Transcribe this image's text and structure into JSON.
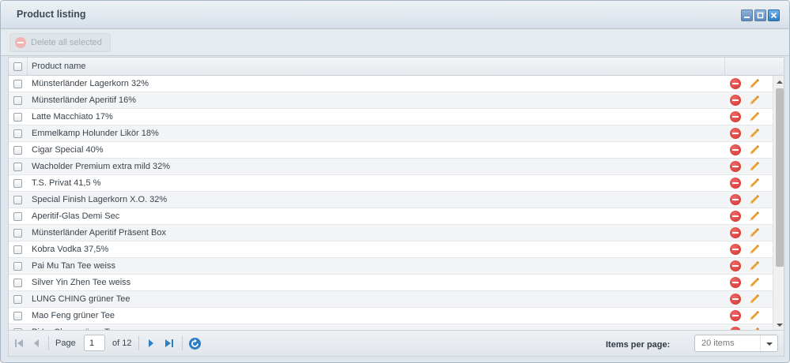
{
  "window": {
    "title": "Product listing",
    "controls": [
      "minimize-icon",
      "maximize-icon",
      "close-icon"
    ]
  },
  "toolbar": {
    "delete_all_label": "Delete all selected"
  },
  "grid": {
    "columns": [
      "Product name"
    ],
    "rows": [
      {
        "name": "Münsterländer Lagerkorn 32%"
      },
      {
        "name": "Münsterländer Aperitif 16%"
      },
      {
        "name": "Latte Macchiato 17%"
      },
      {
        "name": "Emmelkamp Holunder Likör 18%"
      },
      {
        "name": "Cigar Special 40%"
      },
      {
        "name": "Wacholder Premium extra mild 32%"
      },
      {
        "name": "T.S. Privat 41,5 %"
      },
      {
        "name": "Special Finish Lagerkorn X.O. 32%"
      },
      {
        "name": "Aperitif-Glas Demi Sec"
      },
      {
        "name": "Münsterländer Aperitif Präsent Box"
      },
      {
        "name": "Kobra Vodka 37,5%"
      },
      {
        "name": "Pai Mu Tan Tee weiss"
      },
      {
        "name": "Silver Yin Zhen Tee weiss"
      },
      {
        "name": "LUNG CHING grüner Tee"
      },
      {
        "name": "Mao Feng grüner Tee"
      },
      {
        "name": "Pi Lo Chun grüner Tee"
      }
    ]
  },
  "pager": {
    "page_label": "Page",
    "current_page": "1",
    "of_label": "of 12",
    "items_per_page_label": "Items per page:",
    "items_per_page_value": "20 items"
  },
  "colors": {
    "delete": "#d6322e",
    "edit": "#e8a030",
    "pager_blue": "#2a7fc7"
  }
}
